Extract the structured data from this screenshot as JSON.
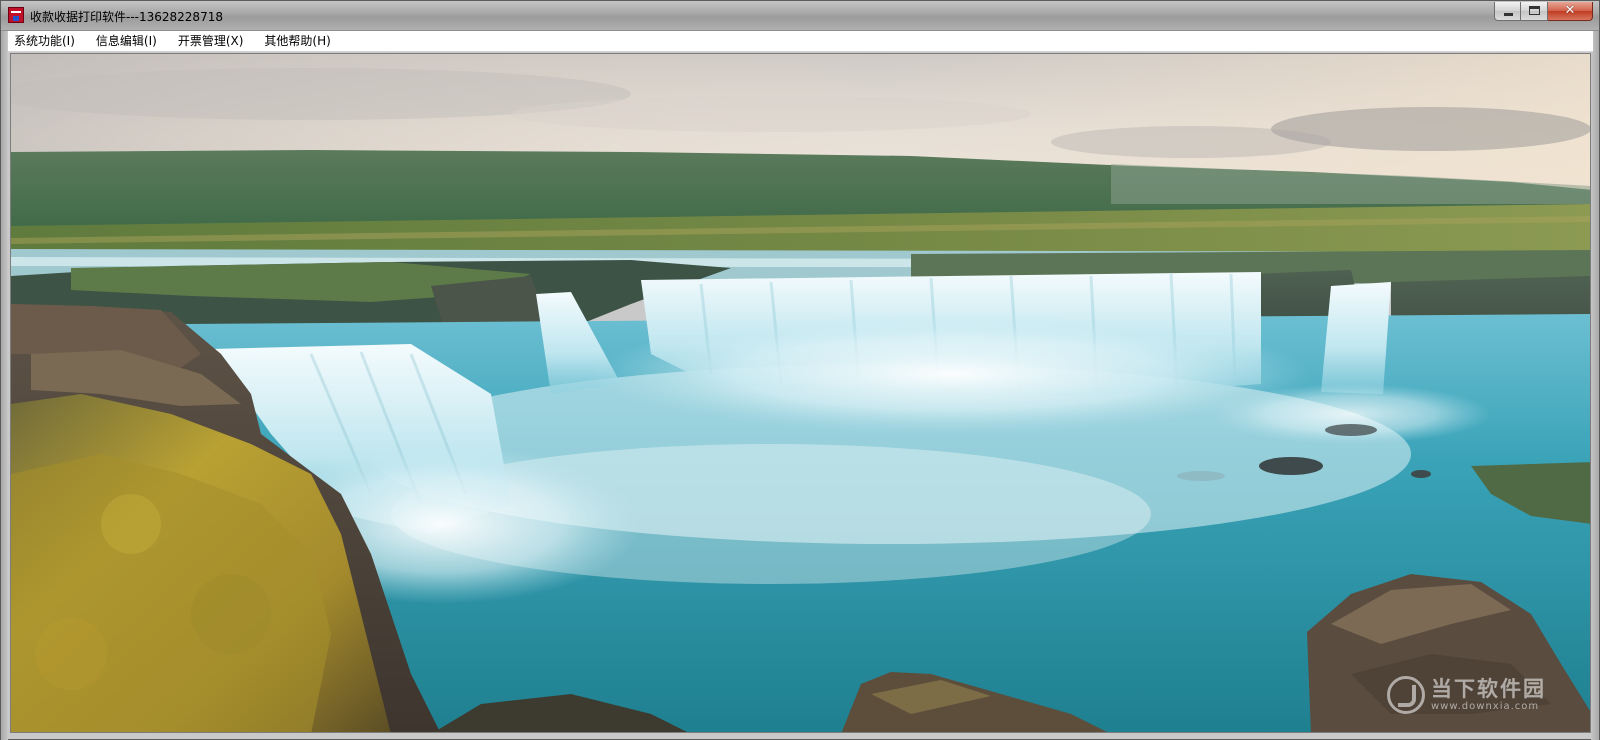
{
  "window": {
    "title": "收款收据打印软件---13628228718",
    "icon": "receipt-app-icon",
    "controls": {
      "minimize": "minimize-icon",
      "maximize": "maximize-icon",
      "close_label": "✕"
    }
  },
  "menubar": {
    "items": [
      {
        "label": "系统功能(I)"
      },
      {
        "label": "信息编辑(I)"
      },
      {
        "label": "开票管理(X)"
      },
      {
        "label": "其他帮助(H)"
      }
    ]
  },
  "content": {
    "scene": "waterfall-landscape",
    "watermark": {
      "main": "当下软件园",
      "sub": "www.downxia.com"
    }
  },
  "colors": {
    "titlebar": "#a6a6a6",
    "menubar": "#ffffff",
    "close_button": "#c03b22",
    "water": "#2a93a8",
    "moss": "#b9a133",
    "sky": "#e6dfd6"
  }
}
